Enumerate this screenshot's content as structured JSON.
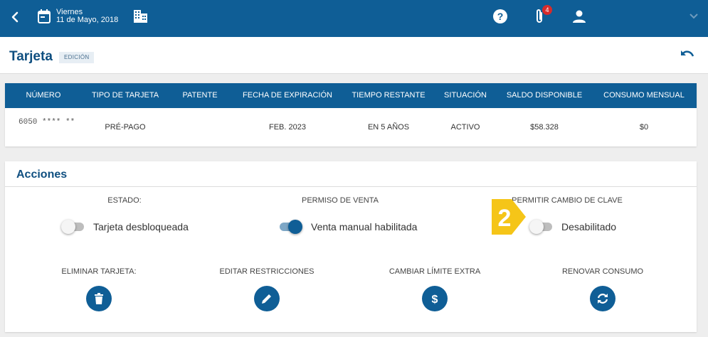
{
  "topbar": {
    "weekday": "Viernes",
    "date": "11 de Mayo, 2018",
    "notifications_count": "4",
    "icons": [
      "back-arrow-icon",
      "calendar-icon",
      "building-icon",
      "help-icon",
      "paperclip-icon",
      "user-icon",
      "chevron-down-icon"
    ]
  },
  "header": {
    "title": "Tarjeta",
    "tag": "EDICIÓN"
  },
  "table": {
    "headers": [
      "NÚMERO",
      "TIPO DE TARJETA",
      "PATENTE",
      "FECHA DE EXPIRACIÓN",
      "TIEMPO RESTANTE",
      "SITUACIÓN",
      "SALDO DISPONIBLE",
      "CONSUMO MENSUAL"
    ],
    "row": {
      "numero": "6050 **** **",
      "tipo": "PRÉ-PAGO",
      "patente": "",
      "expiracion": "FEB. 2023",
      "tiempo": "EN 5 AÑOS",
      "situacion": "ACTIVO",
      "saldo": "$58.328",
      "consumo": "$0"
    }
  },
  "acciones": {
    "title": "Acciones",
    "toggles": [
      {
        "label": "ESTADO:",
        "text": "Tarjeta desbloqueada",
        "on": false
      },
      {
        "label": "PERMISO DE VENTA",
        "text": "Venta manual habilitada",
        "on": true
      },
      {
        "label": "PERMITIR CAMBIO DE CLAVE",
        "text": "Desabilitado",
        "on": false
      }
    ],
    "buttons": [
      {
        "label": "ELIMINAR TARJETA:",
        "icon": "trash-icon"
      },
      {
        "label": "EDITAR RESTRICCIONES",
        "icon": "pencil-icon"
      },
      {
        "label": "CAMBIAR LÍMITE EXTRA",
        "icon": "dollar-icon"
      },
      {
        "label": "RENOVAR CONSUMO",
        "icon": "refresh-icon"
      }
    ]
  },
  "marker": {
    "number": "2",
    "color": "#f5c518"
  },
  "colors": {
    "primary": "#0f5e96",
    "title": "#0f4f80",
    "badge": "#d72b2b"
  }
}
